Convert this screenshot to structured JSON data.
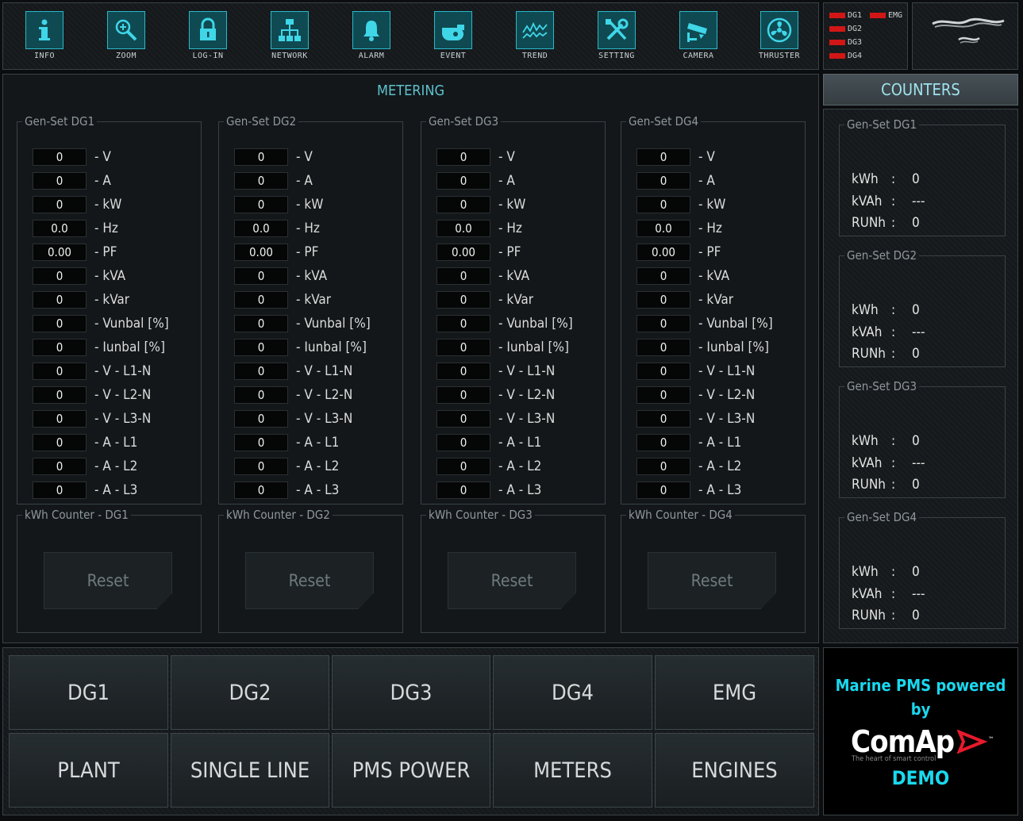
{
  "toolbar": [
    {
      "label": "INFO",
      "icon": "info-icon"
    },
    {
      "label": "ZOOM",
      "icon": "zoom-icon"
    },
    {
      "label": "LOG-IN",
      "icon": "lock-icon"
    },
    {
      "label": "NETWORK",
      "icon": "network-icon"
    },
    {
      "label": "ALARM",
      "icon": "bell-icon"
    },
    {
      "label": "EVENT",
      "icon": "event-icon"
    },
    {
      "label": "TREND",
      "icon": "trend-icon"
    },
    {
      "label": "SETTING",
      "icon": "tools-icon"
    },
    {
      "label": "CAMERA",
      "icon": "camera-icon"
    },
    {
      "label": "THRUSTER",
      "icon": "fan-icon"
    }
  ],
  "status": {
    "dg1": "DG1",
    "dg2": "DG2",
    "dg3": "DG3",
    "dg4": "DG4",
    "emg": "EMG",
    "led_color": "#d11616"
  },
  "metering": {
    "title": "METERING",
    "units": [
      "- V",
      "- A",
      "- kW",
      "- Hz",
      "- PF",
      "- kVA",
      "- kVar",
      "- Vunbal [%]",
      "- Iunbal [%]",
      "- V - L1-N",
      "- V - L2-N",
      "- V - L3-N",
      "- A - L1",
      "- A - L2",
      "- A - L3"
    ],
    "gensets": [
      {
        "title": "Gen-Set DG1",
        "values": [
          "0",
          "0",
          "0",
          "0.0",
          "0.00",
          "0",
          "0",
          "0",
          "0",
          "0",
          "0",
          "0",
          "0",
          "0",
          "0"
        ],
        "kwh_title": "kWh Counter - DG1",
        "reset": "Reset"
      },
      {
        "title": "Gen-Set DG2",
        "values": [
          "0",
          "0",
          "0",
          "0.0",
          "0.00",
          "0",
          "0",
          "0",
          "0",
          "0",
          "0",
          "0",
          "0",
          "0",
          "0"
        ],
        "kwh_title": "kWh Counter - DG2",
        "reset": "Reset"
      },
      {
        "title": "Gen-Set DG3",
        "values": [
          "0",
          "0",
          "0",
          "0.0",
          "0.00",
          "0",
          "0",
          "0",
          "0",
          "0",
          "0",
          "0",
          "0",
          "0",
          "0"
        ],
        "kwh_title": "kWh Counter - DG3",
        "reset": "Reset"
      },
      {
        "title": "Gen-Set DG4",
        "values": [
          "0",
          "0",
          "0",
          "0.0",
          "0.00",
          "0",
          "0",
          "0",
          "0",
          "0",
          "0",
          "0",
          "0",
          "0",
          "0"
        ],
        "kwh_title": "kWh Counter - DG4",
        "reset": "Reset"
      }
    ]
  },
  "counters": {
    "header": "COUNTERS",
    "items": [
      {
        "title": "Gen-Set DG1",
        "kwh": "0",
        "kvah": "---",
        "runh": "0"
      },
      {
        "title": "Gen-Set DG2",
        "kwh": "0",
        "kvah": "---",
        "runh": "0"
      },
      {
        "title": "Gen-Set DG3",
        "kwh": "0",
        "kvah": "---",
        "runh": "0"
      },
      {
        "title": "Gen-Set DG4",
        "kwh": "0",
        "kvah": "---",
        "runh": "0"
      }
    ],
    "labels": {
      "kwh": "kWh",
      "kvah": "kVAh",
      "runh": "RUNh",
      "colon": ":"
    }
  },
  "nav": [
    "DG1",
    "DG2",
    "DG3",
    "DG4",
    "EMG",
    "PLANT",
    "SINGLE LINE",
    "PMS POWER",
    "METERS",
    "ENGINES"
  ],
  "brand": {
    "line1": "Marine PMS powered",
    "line2": "by",
    "company": "ComAp",
    "tagline": "The heart of smart control",
    "demo": "DEMO",
    "tm": "™"
  },
  "colors": {
    "accent": "#19d9ef",
    "icon_border": "#2bb7c9",
    "icon_bg": "#0f4a52",
    "alarm_red": "#d11616"
  }
}
